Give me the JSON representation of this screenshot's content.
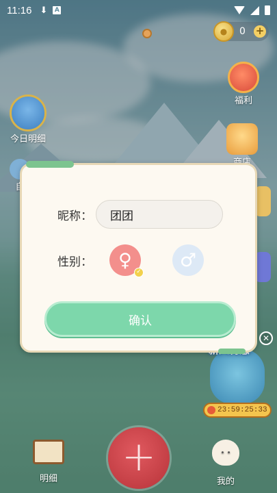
{
  "status_bar": {
    "time": "11:16"
  },
  "coins": {
    "count": "0",
    "plus": "+"
  },
  "side": {
    "fuli_label": "福利",
    "shop_label": "商店",
    "mingxi_today_label": "今日明细",
    "left_partial_label": "自"
  },
  "promo": {
    "title": "新人特惠",
    "timer": "23:59:25:33",
    "close": "✕"
  },
  "dialog": {
    "nickname_label": "昵称：",
    "nickname_value": "团团",
    "gender_label": "性别：",
    "female_symbol": "♀",
    "male_symbol": "♂",
    "selected_gender": "female",
    "confirm_label": "确认"
  },
  "nav": {
    "left_label": "明细",
    "fab": "+",
    "right_label": "我的"
  },
  "colors": {
    "confirm": "#7dd7ab",
    "female": "#f38f8c",
    "male": "#dde9f6",
    "fab": "#c94249"
  }
}
